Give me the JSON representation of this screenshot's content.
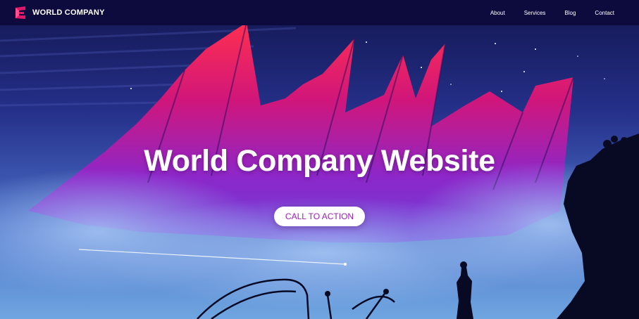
{
  "brand": {
    "name": "WORLD COMPANY",
    "logo_icon": "stylized-e-logo-icon"
  },
  "nav": {
    "links": [
      "About",
      "Services",
      "Blog",
      "Contact"
    ]
  },
  "hero": {
    "title": "World Company Website",
    "cta_label": "CALL TO ACTION"
  },
  "colors": {
    "navbar": "#0d0b3d",
    "sky": "#1b2470",
    "accent": "#e0176a",
    "cta_text": "#9b1eb3"
  }
}
